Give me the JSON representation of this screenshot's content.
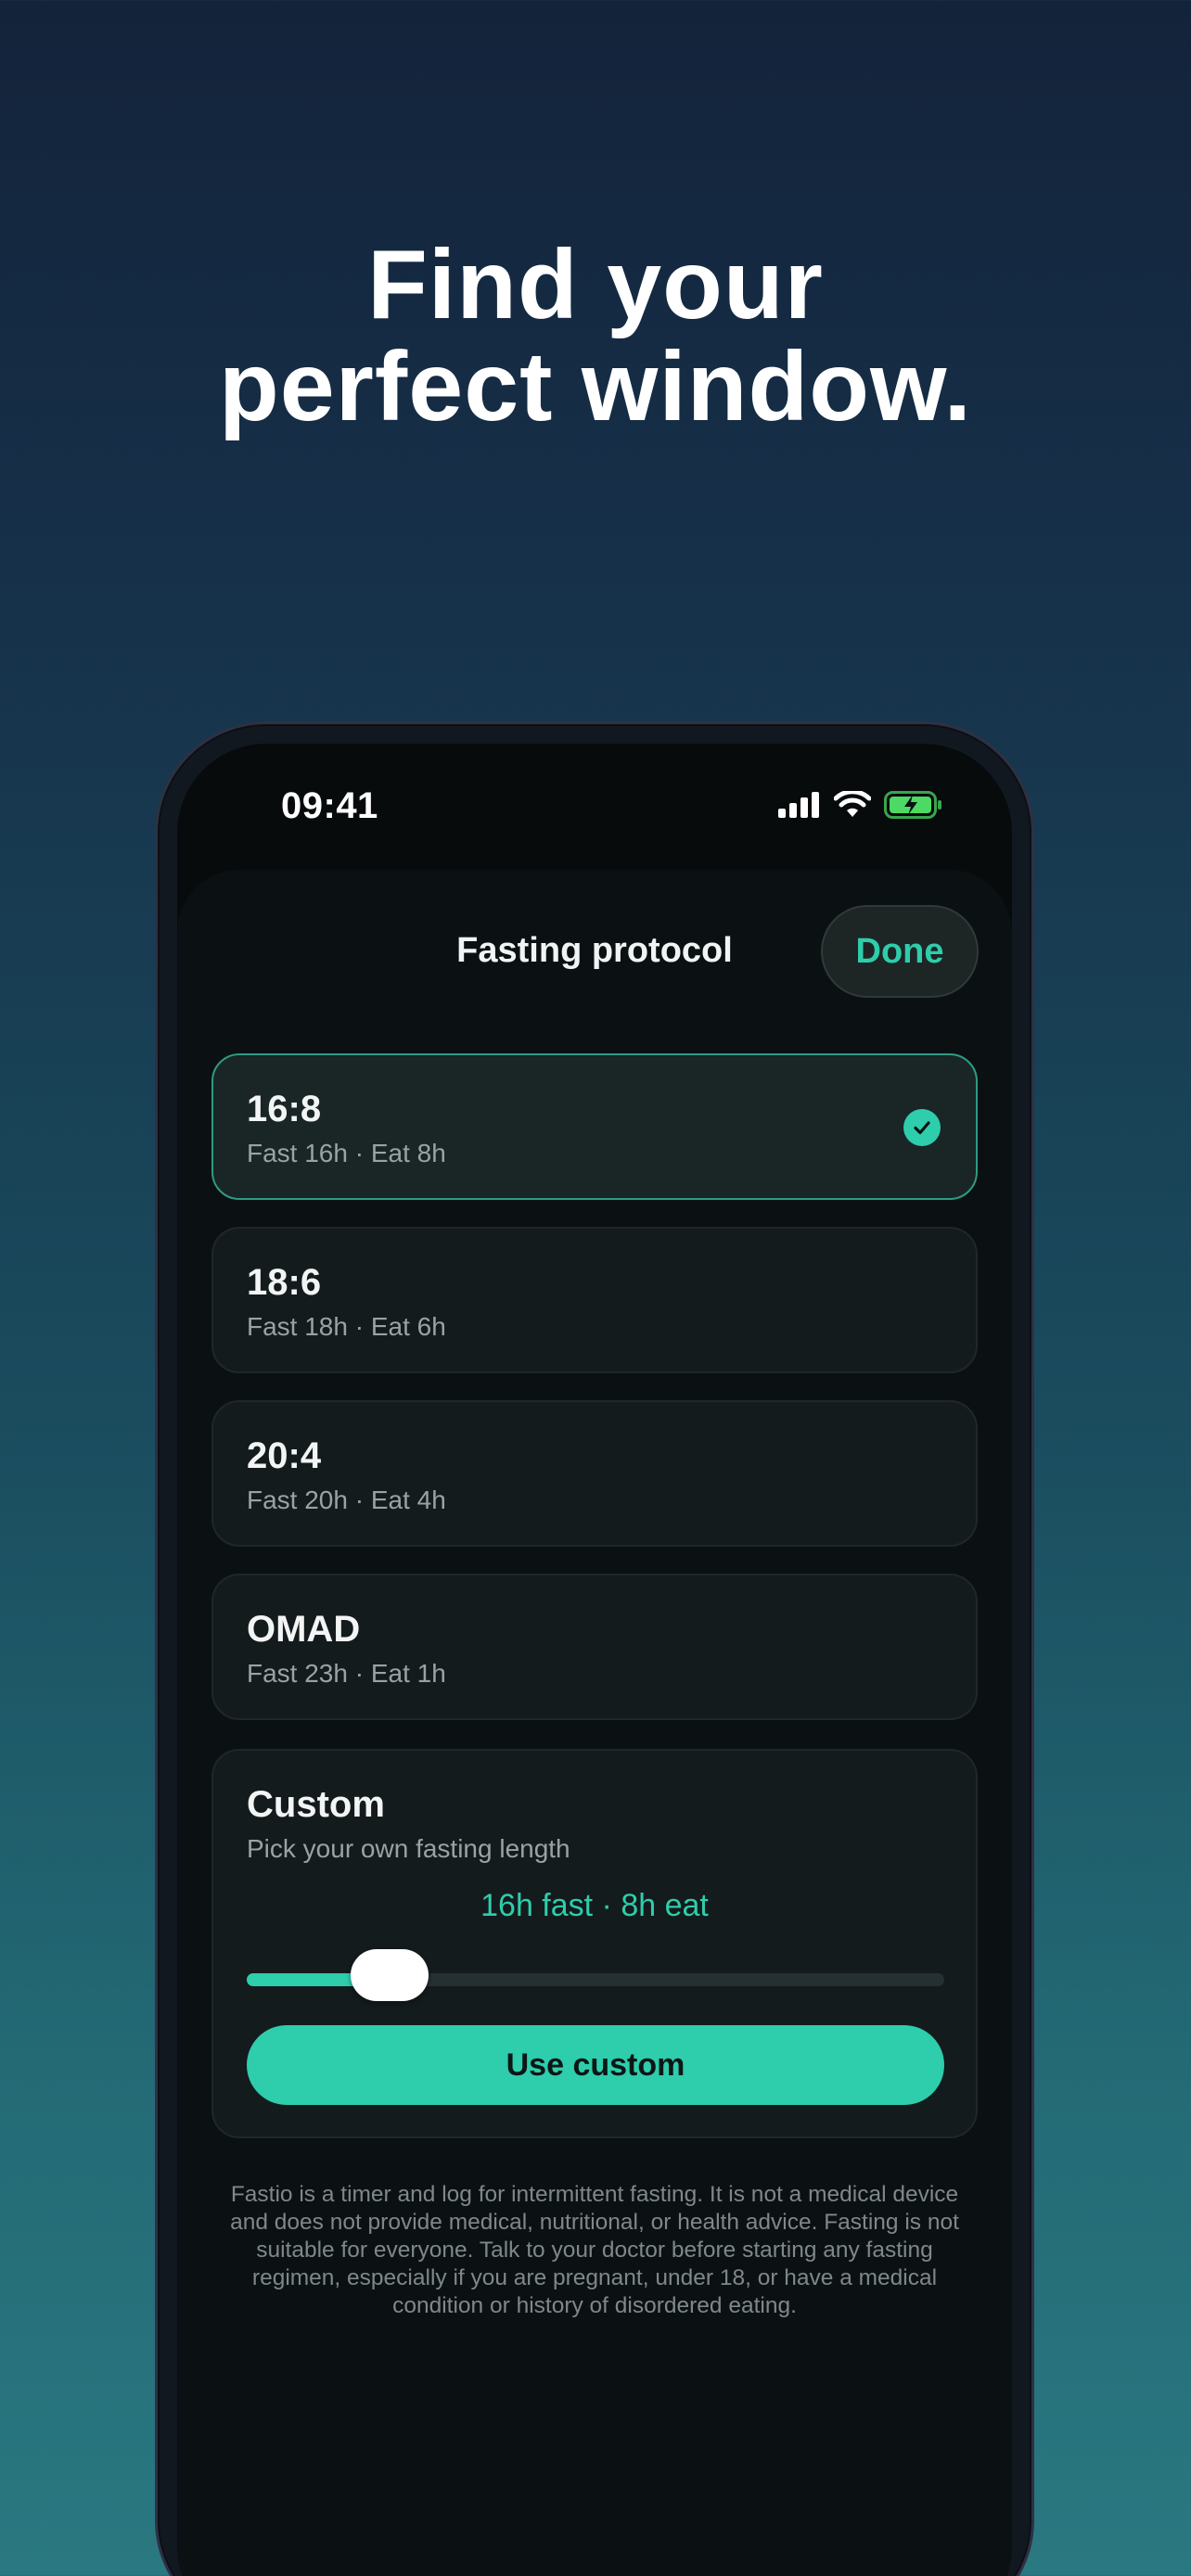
{
  "headline": {
    "line1": "Find your",
    "line2": "perfect window."
  },
  "status_bar": {
    "time": "09:41",
    "icons": [
      "cellular-signal-icon",
      "wifi-icon",
      "battery-charging-icon"
    ],
    "battery_color": "#4cd964"
  },
  "sheet": {
    "title": "Fasting protocol",
    "done_label": "Done"
  },
  "protocols": [
    {
      "title": "16:8",
      "subtitle": "Fast 16h · Eat 8h",
      "selected": true
    },
    {
      "title": "18:6",
      "subtitle": "Fast 18h · Eat 6h",
      "selected": false
    },
    {
      "title": "20:4",
      "subtitle": "Fast 20h · Eat 4h",
      "selected": false
    },
    {
      "title": "OMAD",
      "subtitle": "Fast 23h · Eat 1h",
      "selected": false
    }
  ],
  "custom": {
    "title": "Custom",
    "subtitle": "Pick your own fasting length",
    "value_label": "16h fast · 8h eat",
    "slider_fraction": 0.205,
    "button_label": "Use custom"
  },
  "disclaimer": "Fastio is a timer and log for intermittent fasting. It is not a medical device and does not provide medical, nutritional, or health advice. Fasting is not suitable for everyone. Talk to your doctor before starting any fasting regimen, especially if you are pregnant, under 18, or have a medical condition or history of disordered eating.",
  "colors": {
    "accent": "#2ecdab",
    "background_top": "#13233a",
    "background_bottom": "#2a7881"
  }
}
